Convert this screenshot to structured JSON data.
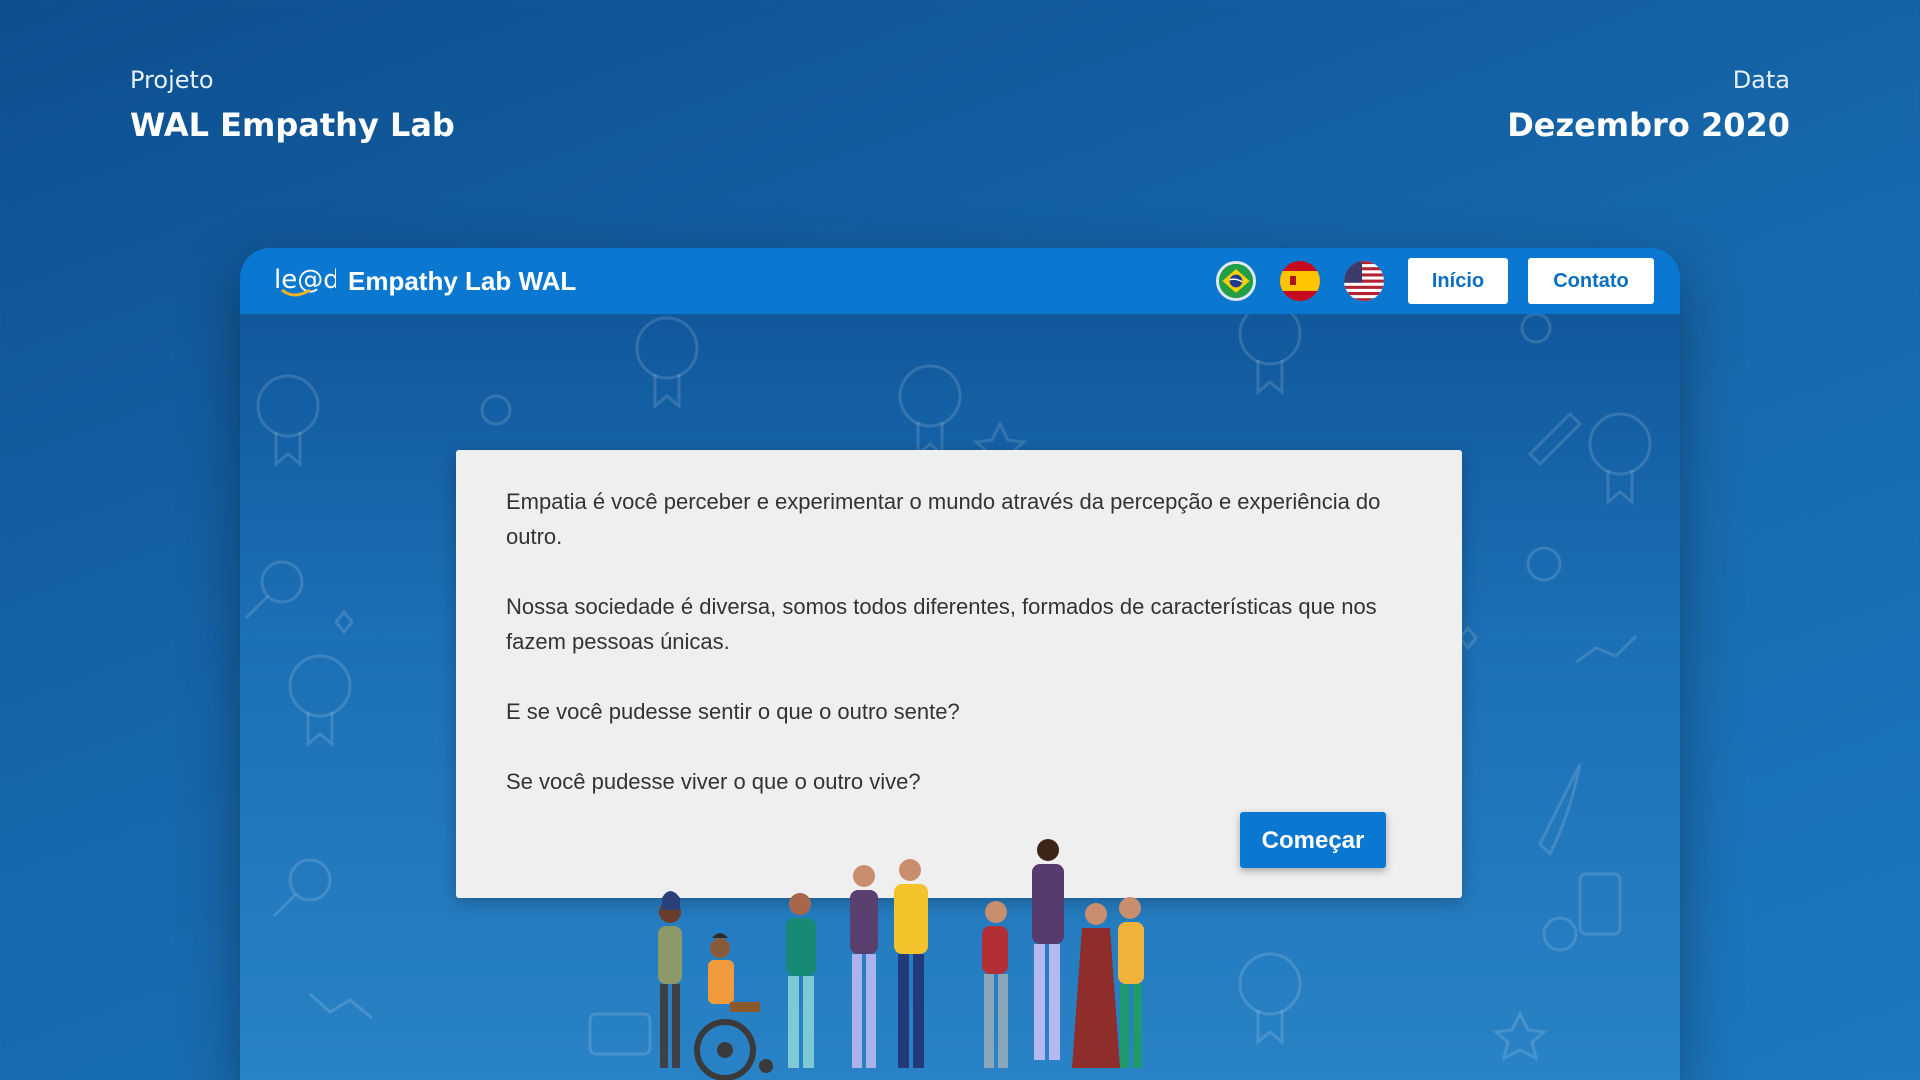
{
  "project": {
    "label": "Projeto",
    "name": "WAL Empathy Lab"
  },
  "date": {
    "label": "Data",
    "value": "Dezembro 2020"
  },
  "navbar": {
    "logo_text": "le@d",
    "brand": "Empathy Lab WAL",
    "flags": [
      "brazil-flag-icon",
      "spain-flag-icon",
      "usa-flag-icon"
    ],
    "buttons": {
      "home": "Início",
      "contact": "Contato"
    },
    "bg_color": "#0a77d0"
  },
  "card": {
    "paragraphs": [
      "Empatia é você perceber e experimentar o mundo através da percepção e experiência do outro.",
      "Nossa sociedade é diversa, somos todos diferentes, formados de características que nos fazem pessoas únicas.",
      "E se você pudesse sentir o que o outro sente?",
      "Se você pudesse viver o que o outro vive?"
    ],
    "start_button": "Começar"
  },
  "colors": {
    "accent": "#0a77d0",
    "card_bg": "#efefef",
    "text": "#333333"
  }
}
